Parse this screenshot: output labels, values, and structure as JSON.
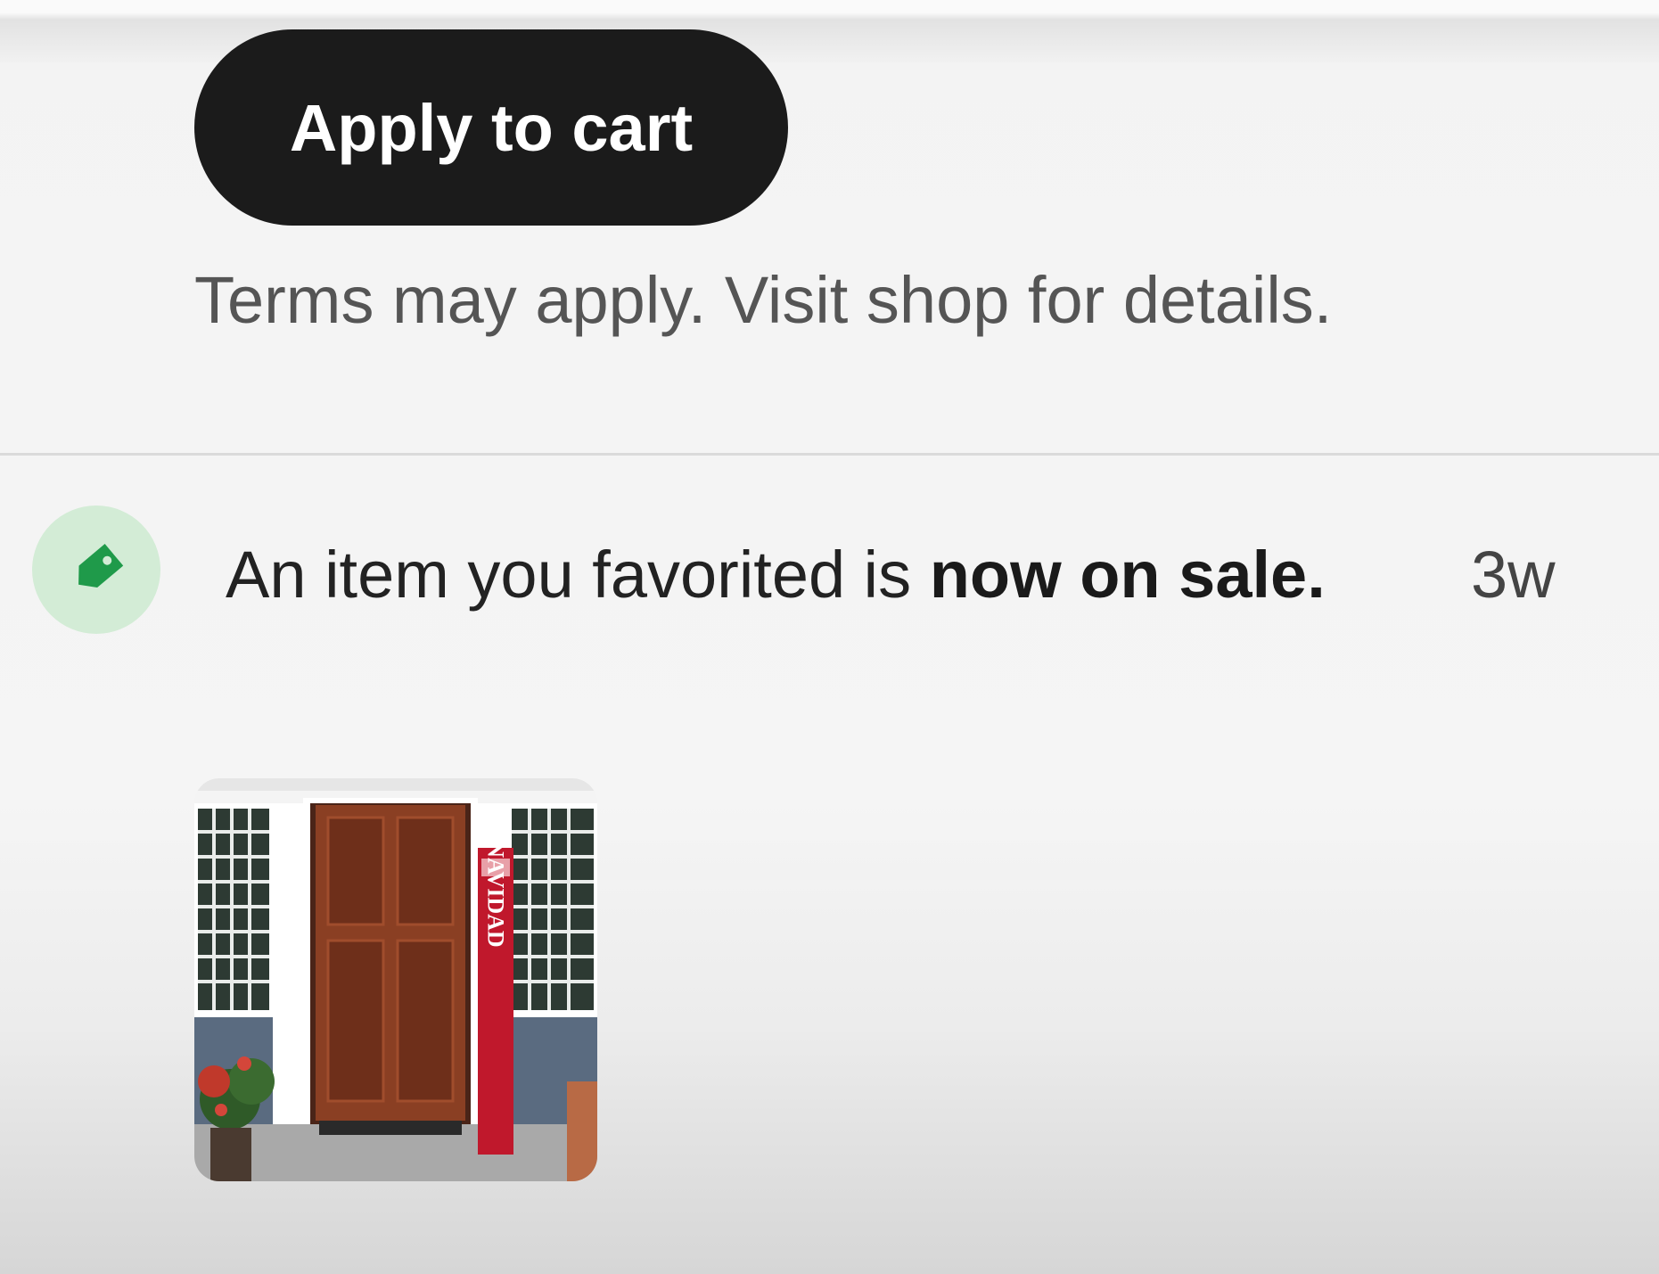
{
  "offer": {
    "apply_label": "Apply to cart",
    "terms": "Terms may apply. Visit shop for details."
  },
  "notification": {
    "icon": "price-tag-icon",
    "icon_color": "#1f9a4a",
    "icon_bg": "#d3ecd6",
    "text_prefix": "An item you favorited is ",
    "text_bold": "now on sale.",
    "time": "3w",
    "item_image": {
      "banner_text": "NAVIDAD"
    }
  }
}
